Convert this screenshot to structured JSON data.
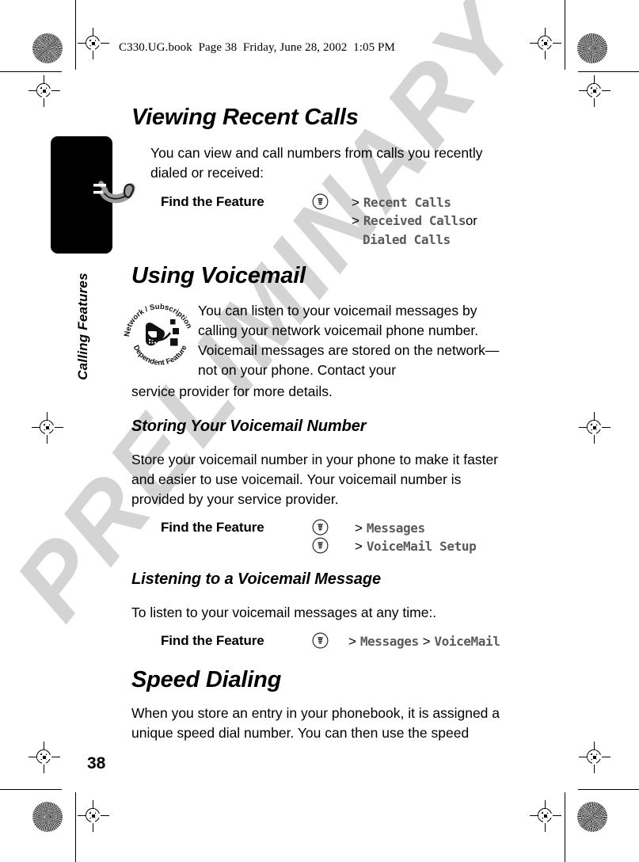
{
  "header": {
    "running_header": "C330.UG.book  Page 38  Friday, June 28, 2002  1:05 PM"
  },
  "watermark": {
    "text": "PRELIMINARY"
  },
  "chapter": {
    "tab_label": "Calling Features",
    "tab_icon": "telephone-handset-icon"
  },
  "sections": {
    "viewing_recent_calls": {
      "heading": "Viewing Recent Calls",
      "body": "You can view and call numbers from calls you recently dialed or received:",
      "find_feature": {
        "label": "Find the Feature",
        "icon": "menu-icon",
        "lines": [
          {
            "prefix": ">",
            "item": "Recent Calls",
            "suffix": ""
          },
          {
            "prefix": ">",
            "item": "Received Calls",
            "suffix": "or"
          },
          {
            "prefix": "",
            "item": "Dialed Calls",
            "suffix": ""
          }
        ]
      }
    },
    "using_voicemail": {
      "heading": "Using Voicemail",
      "badge": {
        "top_text": "Network / Subscription",
        "bottom_text": "Dependent Feature",
        "icon": "network-dependent-phone-icon"
      },
      "body_indented": "You can listen to your voicemail messages by calling your network voicemail phone number. Voicemail messages are stored on the network—not on your phone. Contact your",
      "body_full": "service provider for more details."
    },
    "storing_voicemail_number": {
      "heading": "Storing Your Voicemail Number",
      "body": "Store your voicemail number in your phone to make it faster and easier to use voicemail. Your voicemail number is provided by your service provider.",
      "find_feature": {
        "label": "Find the Feature",
        "icon": "menu-icon",
        "lines": [
          {
            "prefix": ">",
            "item": "Messages",
            "suffix": ""
          },
          {
            "prefix": ">",
            "item": "VoiceMail Setup",
            "suffix": ""
          }
        ]
      }
    },
    "listening_to_voicemail": {
      "heading": "Listening to a Voicemail Message",
      "body": "To listen to your voicemail messages at any time:.",
      "find_feature": {
        "label": "Find the Feature",
        "icon": "menu-icon",
        "line": {
          "prefix": ">",
          "item1": "Messages",
          "sep": ">",
          "item2": "VoiceMail"
        }
      }
    },
    "speed_dialing": {
      "heading": "Speed Dialing",
      "body": "When you store an entry in your phonebook, it is assigned a unique speed dial number. You can then use the speed"
    }
  },
  "footer": {
    "page_number": "38"
  },
  "colors": {
    "ink": "#000000",
    "menu_item": "#5a5a5a",
    "watermark": "#d4d4d4",
    "tab": "#000000",
    "phone_icon": "#9a9a9a"
  }
}
